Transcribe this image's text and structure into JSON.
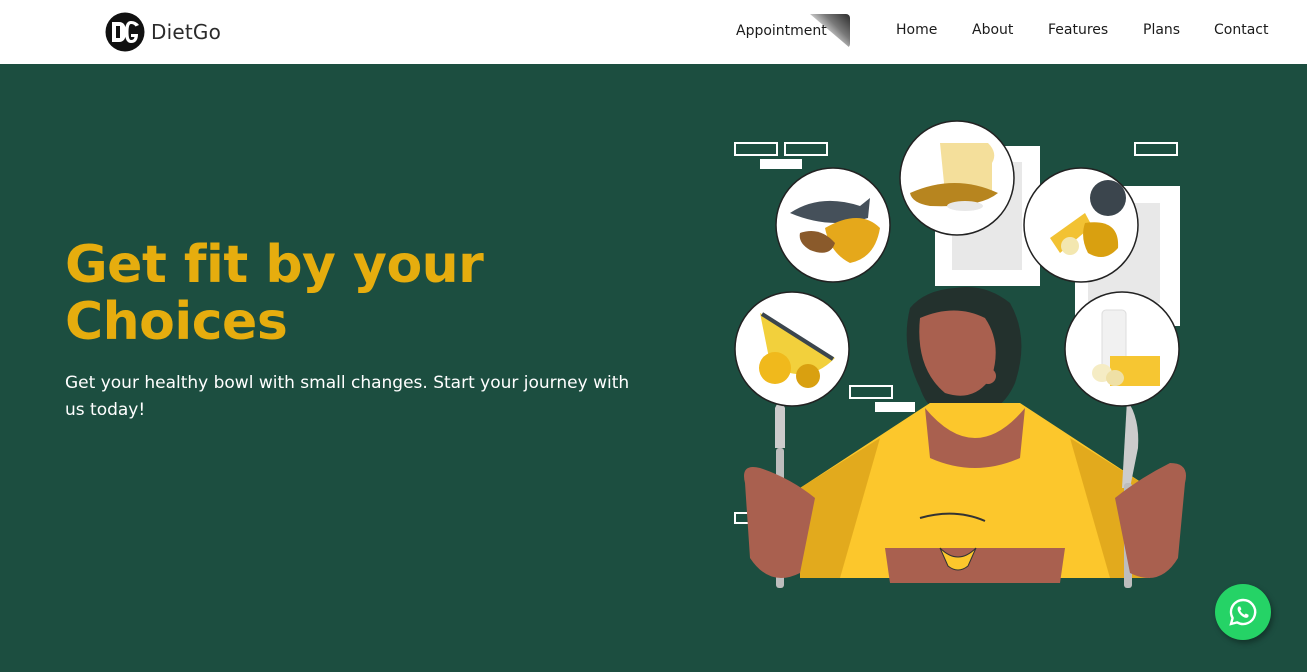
{
  "brand": {
    "name": "DietGo",
    "logo": "DG"
  },
  "nav": {
    "appointment_label": "Appointment",
    "links": [
      "Home",
      "About",
      "Features",
      "Plans",
      "Contact"
    ]
  },
  "hero": {
    "title_line1": "Get fit by your",
    "title_line2": "Choices",
    "subtitle": "Get your healthy bowl with small changes. Start your journey with us today!"
  },
  "floating": {
    "whatsapp_icon": "whatsapp-icon"
  },
  "colors": {
    "hero_bg": "#1c4e40",
    "accent": "#e6ad0e",
    "whatsapp": "#25d366"
  }
}
